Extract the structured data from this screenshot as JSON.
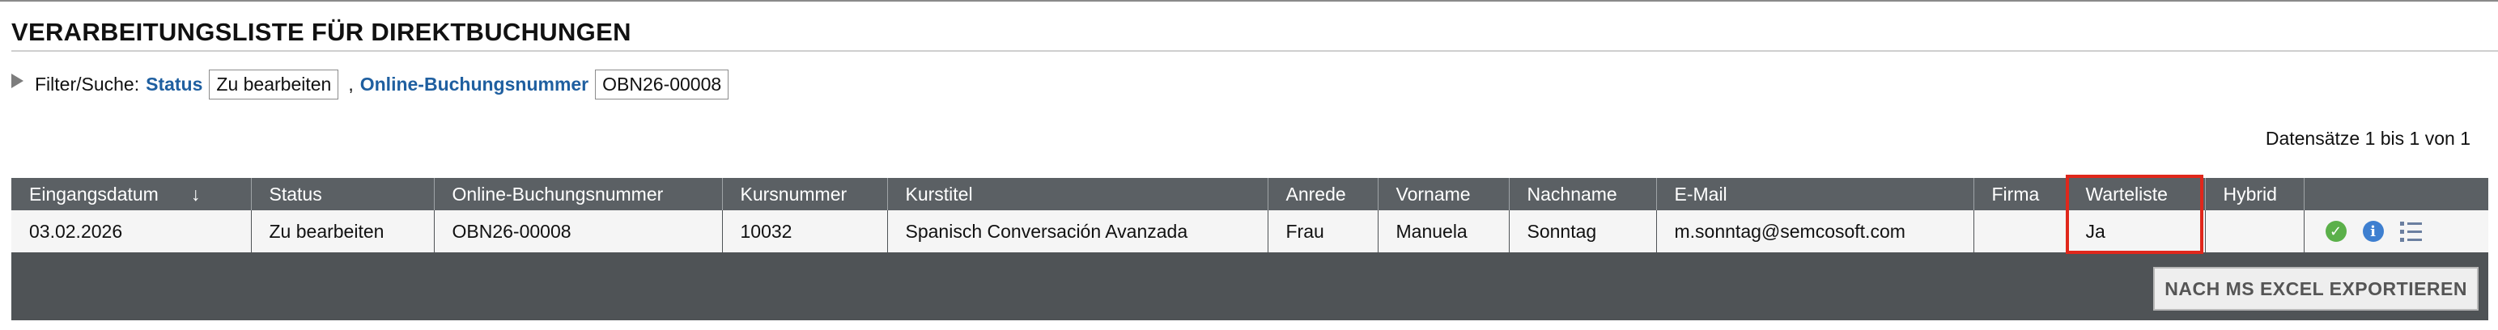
{
  "page": {
    "title": "VERARBEITUNGSLISTE FÜR DIREKTBUCHUNGEN"
  },
  "filter": {
    "label": "Filter/Suche:",
    "status_key": "Status",
    "status_value": "Zu bearbeiten",
    "separator": ",",
    "booking_key": "Online-Buchungsnummer",
    "booking_value": "OBN26-00008"
  },
  "records": {
    "summary": "Datensätze 1 bis 1 von 1"
  },
  "table": {
    "headers": {
      "eingangsdatum": "Eingangsdatum",
      "sort_arrow": "↓",
      "status": "Status",
      "buchungsnummer": "Online-Buchungsnummer",
      "kursnummer": "Kursnummer",
      "kurstitel": "Kurstitel",
      "anrede": "Anrede",
      "vorname": "Vorname",
      "nachname": "Nachname",
      "email": "E-Mail",
      "firma": "Firma",
      "warteliste": "Warteliste",
      "hybrid": "Hybrid"
    },
    "rows": [
      {
        "eingangsdatum": "03.02.2026",
        "status": "Zu bearbeiten",
        "buchungsnummer": "OBN26-00008",
        "kursnummer": "10032",
        "kurstitel": "Spanisch Conversación Avanzada",
        "anrede": "Frau",
        "vorname": "Manuela",
        "nachname": "Sonntag",
        "email": "m.sonntag@semcosoft.com",
        "firma": "",
        "warteliste": "Ja",
        "hybrid": ""
      }
    ],
    "row_icons": [
      "check-circle-icon",
      "info-icon",
      "list-icon"
    ],
    "info_glyph": "i",
    "check_glyph": "✓"
  },
  "export": {
    "label": "NACH MS EXCEL EXPORTIEREN"
  },
  "colors": {
    "accent_link": "#1f5fa0",
    "header_bg": "#5b6064",
    "highlight": "#e0271b",
    "ok": "#5bb04a",
    "info": "#3e7fd0"
  }
}
